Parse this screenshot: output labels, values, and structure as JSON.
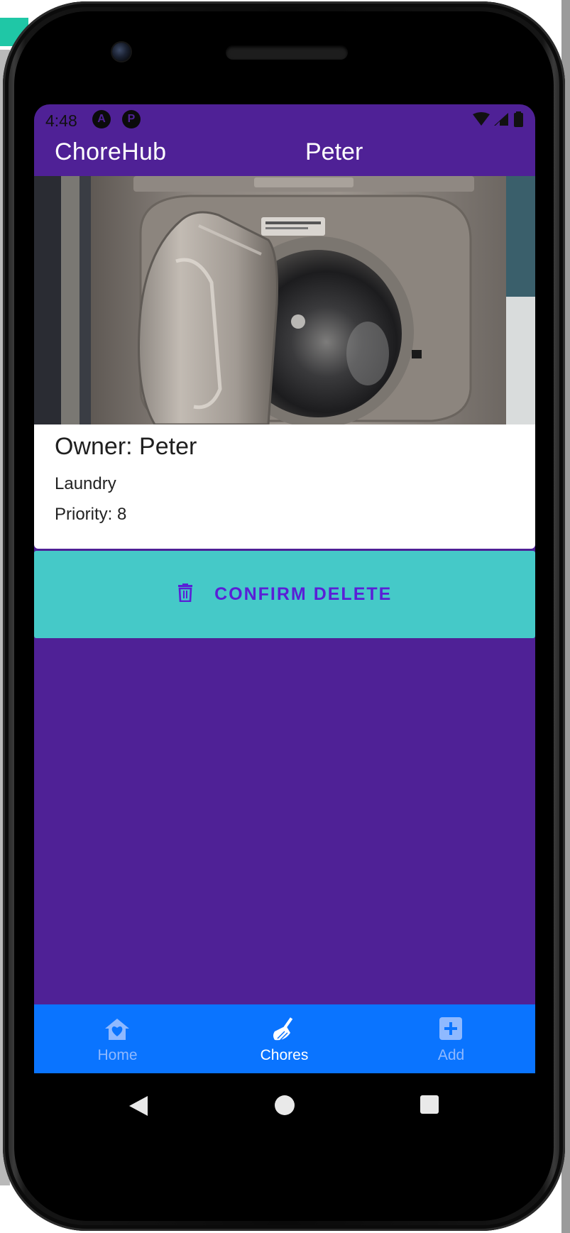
{
  "status_bar": {
    "time": "4:48"
  },
  "app_bar": {
    "title": "ChoreHub",
    "user": "Peter"
  },
  "chore": {
    "image_description_icon": "washing-machine-photo",
    "owner": "Owner: Peter",
    "name": "Laundry",
    "priority": "Priority: 8"
  },
  "actions": {
    "delete_label": "CONFIRM DELETE",
    "delete_icon": "trash-icon"
  },
  "bottom_nav": {
    "items": [
      {
        "label": "Home",
        "icon": "home-heart-icon",
        "active": false
      },
      {
        "label": "Chores",
        "icon": "broom-icon",
        "active": true
      },
      {
        "label": "Add",
        "icon": "plus-square-icon",
        "active": false
      }
    ]
  },
  "colors": {
    "primary": "#4f2196",
    "accent": "#45c9c8",
    "nav": "#0a74ff",
    "button_text": "#5a1fd6"
  }
}
